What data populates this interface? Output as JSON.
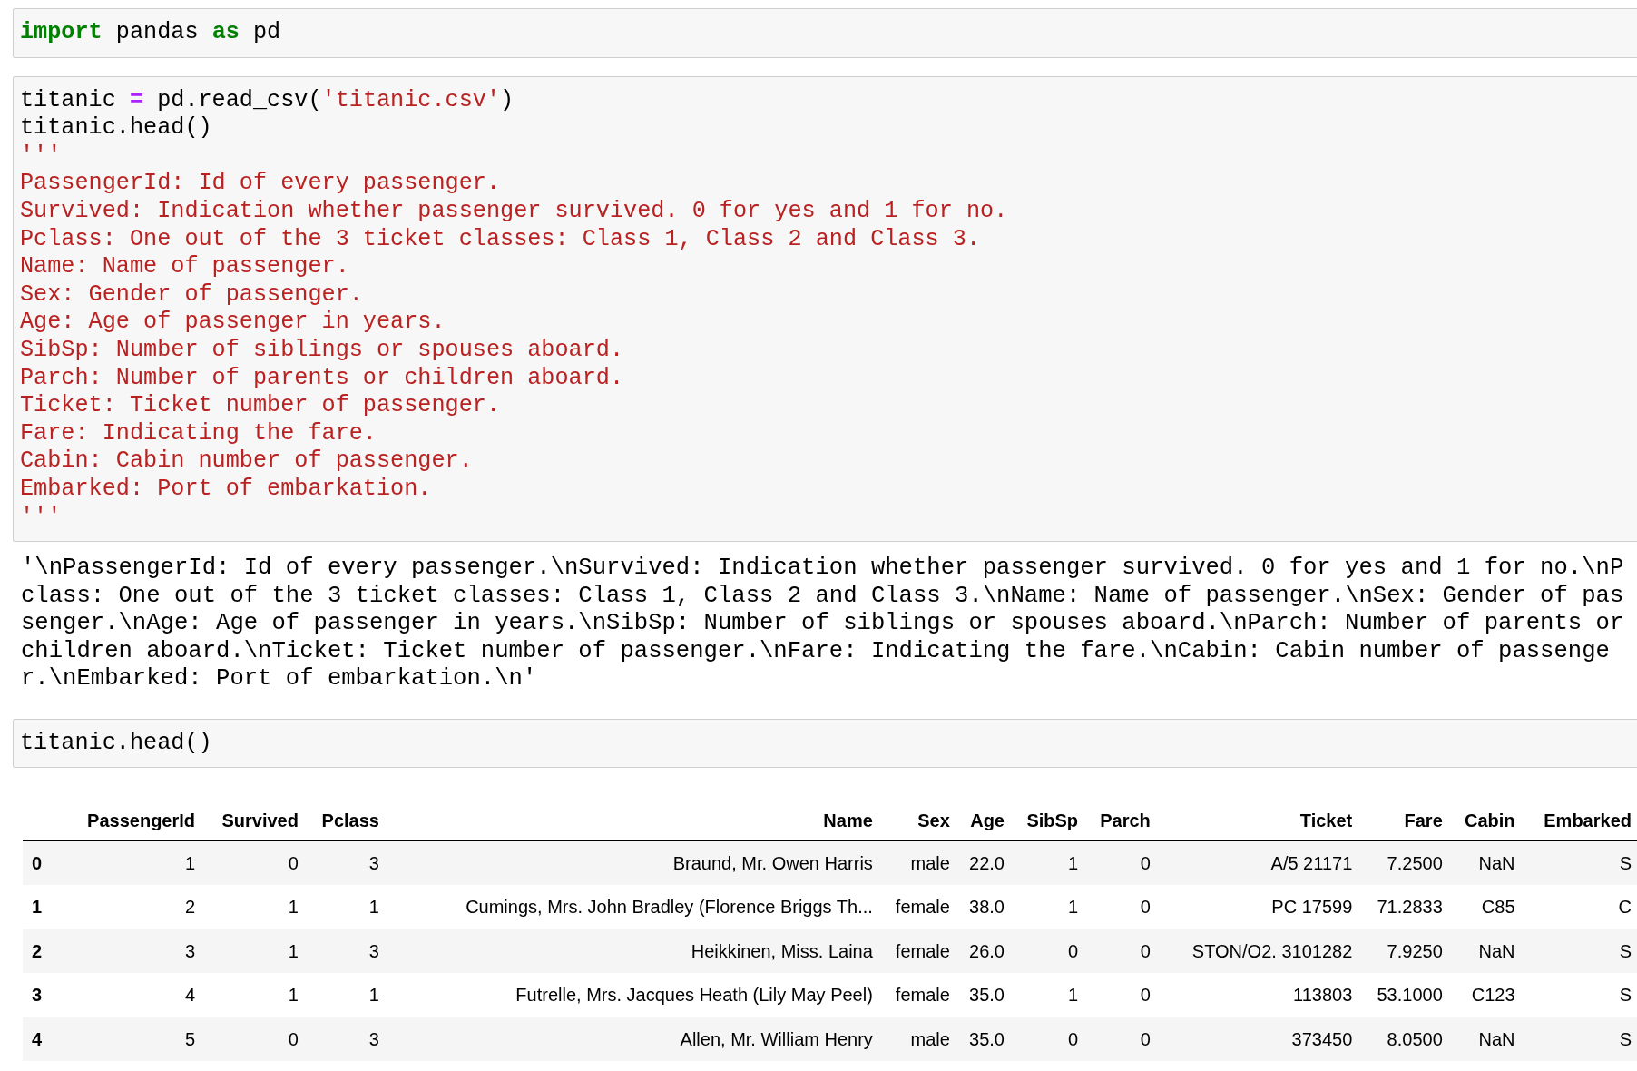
{
  "cells": [
    {
      "kind": "code",
      "lines": [
        [
          {
            "t": "import",
            "kind": "keyword"
          },
          {
            "t": " pandas ",
            "kind": "plain"
          },
          {
            "t": "as",
            "kind": "keyword"
          },
          {
            "t": " pd",
            "kind": "plain"
          }
        ]
      ]
    },
    {
      "kind": "code",
      "lines": [
        [
          {
            "t": "titanic ",
            "kind": "plain"
          },
          {
            "t": "=",
            "kind": "operator"
          },
          {
            "t": " pd.read_csv(",
            "kind": "plain"
          },
          {
            "t": "'titanic.csv'",
            "kind": "string"
          },
          {
            "t": ")",
            "kind": "plain"
          }
        ],
        [
          {
            "t": "titanic.head()",
            "kind": "plain"
          }
        ],
        [
          {
            "t": "'''",
            "kind": "string"
          }
        ],
        [
          {
            "t": "PassengerId: Id of every passenger.",
            "kind": "string"
          }
        ],
        [
          {
            "t": "Survived: Indication whether passenger survived. 0 for yes and 1 for no.",
            "kind": "string"
          }
        ],
        [
          {
            "t": "Pclass: One out of the 3 ticket classes: Class 1, Class 2 and Class 3.",
            "kind": "string"
          }
        ],
        [
          {
            "t": "Name: Name of passenger.",
            "kind": "string"
          }
        ],
        [
          {
            "t": "Sex: Gender of passenger.",
            "kind": "string"
          }
        ],
        [
          {
            "t": "Age: Age of passenger in years.",
            "kind": "string"
          }
        ],
        [
          {
            "t": "SibSp: Number of siblings or spouses aboard.",
            "kind": "string"
          }
        ],
        [
          {
            "t": "Parch: Number of parents or children aboard.",
            "kind": "string"
          }
        ],
        [
          {
            "t": "Ticket: Ticket number of passenger.",
            "kind": "string"
          }
        ],
        [
          {
            "t": "Fare: Indicating the fare.",
            "kind": "string"
          }
        ],
        [
          {
            "t": "Cabin: Cabin number of passenger.",
            "kind": "string"
          }
        ],
        [
          {
            "t": "Embarked: Port of embarkation.",
            "kind": "string"
          }
        ],
        [
          {
            "t": "'''",
            "kind": "string"
          }
        ]
      ]
    },
    {
      "kind": "output",
      "text": "'\\nPassengerId: Id of every passenger.\\nSurvived: Indication whether passenger survived. 0 for yes and 1 for no.\\nPclass: One out of the 3 ticket classes: Class 1, Class 2 and Class 3.\\nName: Name of passenger.\\nSex: Gender of passenger.\\nAge: Age of passenger in years.\\nSibSp: Number of siblings or spouses aboard.\\nParch: Number of parents or children aboard.\\nTicket: Ticket number of passenger.\\nFare: Indicating the fare.\\nCabin: Cabin number of passenger.\\nEmbarked: Port of embarkation.\\n'"
    },
    {
      "kind": "code",
      "lines": [
        [
          {
            "t": "titanic.head()",
            "kind": "plain"
          }
        ]
      ]
    },
    {
      "kind": "dataframe",
      "columns": [
        "PassengerId",
        "Survived",
        "Pclass",
        "Name",
        "Sex",
        "Age",
        "SibSp",
        "Parch",
        "Ticket",
        "Fare",
        "Cabin",
        "Embarked"
      ],
      "rows": [
        {
          "index": "0",
          "values": [
            "1",
            "0",
            "3",
            "Braund, Mr. Owen Harris",
            "male",
            "22.0",
            "1",
            "0",
            "A/5 21171",
            "7.2500",
            "NaN",
            "S"
          ]
        },
        {
          "index": "1",
          "values": [
            "2",
            "1",
            "1",
            "Cumings, Mrs. John Bradley (Florence Briggs Th...",
            "female",
            "38.0",
            "1",
            "0",
            "PC 17599",
            "71.2833",
            "C85",
            "C"
          ]
        },
        {
          "index": "2",
          "values": [
            "3",
            "1",
            "3",
            "Heikkinen, Miss. Laina",
            "female",
            "26.0",
            "0",
            "0",
            "STON/O2. 3101282",
            "7.9250",
            "NaN",
            "S"
          ]
        },
        {
          "index": "3",
          "values": [
            "4",
            "1",
            "1",
            "Futrelle, Mrs. Jacques Heath (Lily May Peel)",
            "female",
            "35.0",
            "1",
            "0",
            "113803",
            "53.1000",
            "C123",
            "S"
          ]
        },
        {
          "index": "4",
          "values": [
            "5",
            "0",
            "3",
            "Allen, Mr. William Henry",
            "male",
            "35.0",
            "0",
            "0",
            "373450",
            "8.0500",
            "NaN",
            "S"
          ]
        }
      ]
    }
  ]
}
